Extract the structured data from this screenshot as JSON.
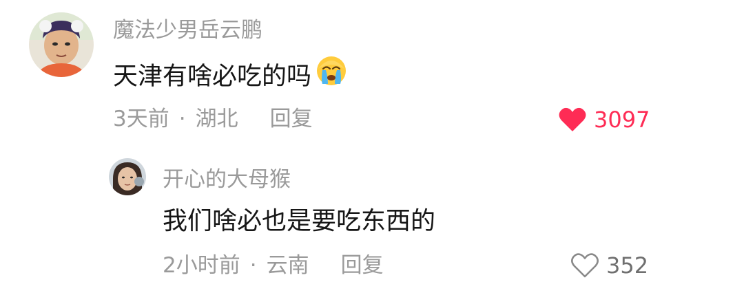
{
  "comments": [
    {
      "username": "魔法少男岳云鹏",
      "text": "天津有啥必吃的吗",
      "emoji": "crying-emoji",
      "time": "3天前",
      "separator": "·",
      "location": "湖北",
      "reply_label": "回复",
      "likes": "3097",
      "liked": true,
      "accent": "#fe2c55"
    },
    {
      "username": "开心的大母猴",
      "text": "我们啥必也是要吃东西的",
      "time": "2小时前",
      "separator": "·",
      "location": "云南",
      "reply_label": "回复",
      "likes": "352",
      "liked": false
    }
  ]
}
